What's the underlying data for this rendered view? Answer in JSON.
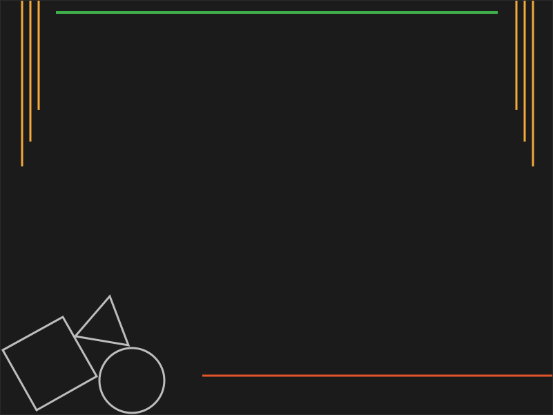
{
  "colors": {
    "background": "#1b1b1b",
    "top_bar": "#3fae4a",
    "corner_lines": "#f4a93a",
    "bottom_bar": "#e0562a",
    "shapes_outline": "#bdbdbd"
  },
  "icons": {
    "square": "square-outline-icon",
    "triangle": "triangle-outline-icon",
    "circle": "circle-outline-icon"
  }
}
